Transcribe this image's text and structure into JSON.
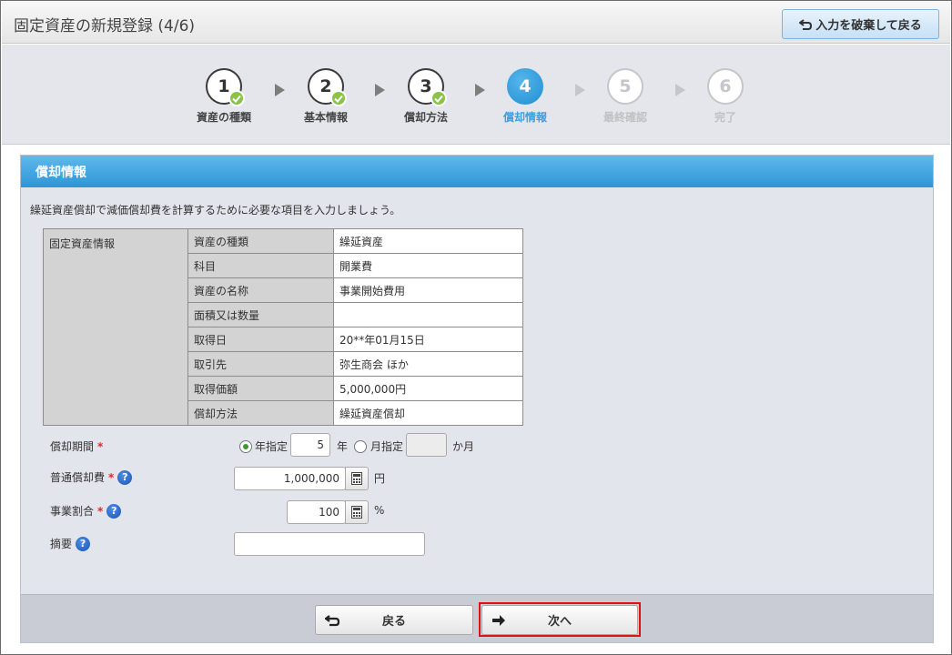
{
  "header": {
    "title": "固定資産の新規登録 (4/6)",
    "discard_label": "入力を破棄して戻る"
  },
  "steps": [
    {
      "num": "1",
      "label": "資産の種類",
      "state": "done"
    },
    {
      "num": "2",
      "label": "基本情報",
      "state": "done"
    },
    {
      "num": "3",
      "label": "償却方法",
      "state": "done"
    },
    {
      "num": "4",
      "label": "償却情報",
      "state": "active"
    },
    {
      "num": "5",
      "label": "最終確認",
      "state": "future"
    },
    {
      "num": "6",
      "label": "完了",
      "state": "future"
    }
  ],
  "panel": {
    "title": "償却情報",
    "intro": "繰延資産償却で減価償却費を計算するために必要な項目を入力しましょう。"
  },
  "info_table": {
    "group_label": "固定資産情報",
    "rows": [
      {
        "key": "資産の種類",
        "value": "繰延資産"
      },
      {
        "key": "科目",
        "value": "開業費"
      },
      {
        "key": "資産の名称",
        "value": "事業開始費用"
      },
      {
        "key": "面積又は数量",
        "value": ""
      },
      {
        "key": "取得日",
        "value": "20**年01月15日"
      },
      {
        "key": "取引先",
        "value": "弥生商会 ほか"
      },
      {
        "key": "取得価額",
        "value": "5,000,000円"
      },
      {
        "key": "償却方法",
        "value": "繰延資産償却"
      }
    ]
  },
  "form": {
    "period_label": "償却期間",
    "required_mark": "*",
    "period_year_option": "年指定",
    "period_year_value": "5",
    "period_year_unit": "年",
    "period_month_option": "月指定",
    "period_month_value": "",
    "period_month_unit": "か月",
    "normal_dep_label": "普通償却費",
    "normal_dep_value": "1,000,000",
    "normal_dep_unit": "円",
    "business_ratio_label": "事業割合",
    "business_ratio_value": "100",
    "business_ratio_unit": "%",
    "memo_label": "摘要",
    "memo_value": "",
    "help_glyph": "?"
  },
  "footer": {
    "back_label": "戻る",
    "next_label": "次へ"
  },
  "colors": {
    "accent": "#2d96d6",
    "required": "#e0262b",
    "done_check": "#8bc34a",
    "highlight": "#e0101a"
  }
}
